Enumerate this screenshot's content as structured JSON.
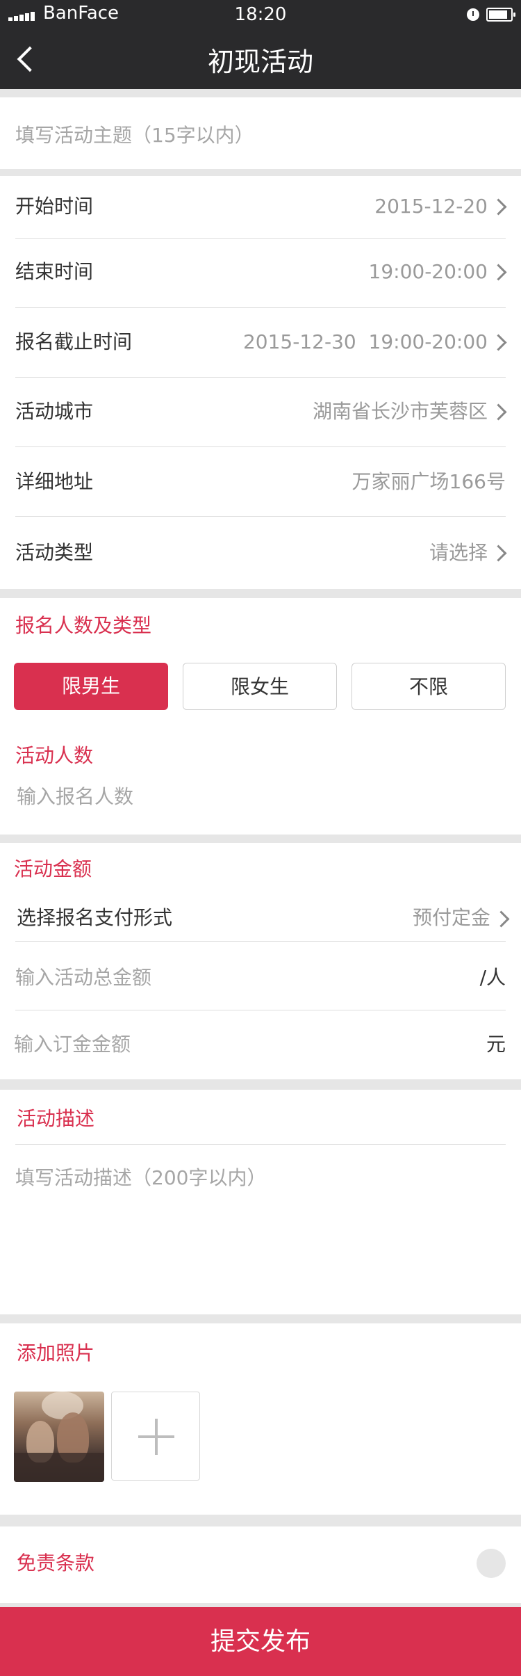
{
  "status_bar": {
    "carrier": "BanFace",
    "time": "18:20"
  },
  "nav": {
    "title": "初现活动"
  },
  "theme": {
    "accent": "#d9304f",
    "bar": "#2a2a2c",
    "background": "#e6e6e6"
  },
  "icons": [
    "back-icon",
    "chevron-right-icon",
    "plus-icon",
    "clock-icon",
    "battery-icon",
    "signal-icon"
  ],
  "topic": {
    "placeholder": "填写活动主题（15字以内）"
  },
  "details": [
    {
      "label": "开始时间",
      "value": "2015-12-20"
    },
    {
      "label": "结束时间",
      "value": "19:00-20:00"
    },
    {
      "label": "报名截止时间",
      "value": "2015-12-30  19:00-20:00"
    },
    {
      "label": "活动城市",
      "value": "湖南省长沙市芙蓉区"
    },
    {
      "label": "详细地址",
      "value": "万家丽广场166号"
    },
    {
      "label": "活动类型",
      "value": "请选择"
    }
  ],
  "signup": {
    "section_title": "报名人数及类型",
    "options": [
      "限男生",
      "限女生",
      "不限"
    ],
    "selected": "限男生",
    "count_title": "活动人数",
    "count_placeholder": "输入报名人数"
  },
  "amount": {
    "section_title": "活动金额",
    "pay_label": "选择报名支付形式",
    "pay_value": "预付定金",
    "total_placeholder": "输入活动总金额",
    "total_unit": "/人",
    "deposit_placeholder": "输入订金金额",
    "deposit_unit": "元"
  },
  "description": {
    "section_title": "活动描述",
    "placeholder": "填写活动描述（200字以内）"
  },
  "photos": {
    "section_title": "添加照片"
  },
  "disclaimer": {
    "label": "免责条款"
  },
  "submit_label": "提交发布"
}
